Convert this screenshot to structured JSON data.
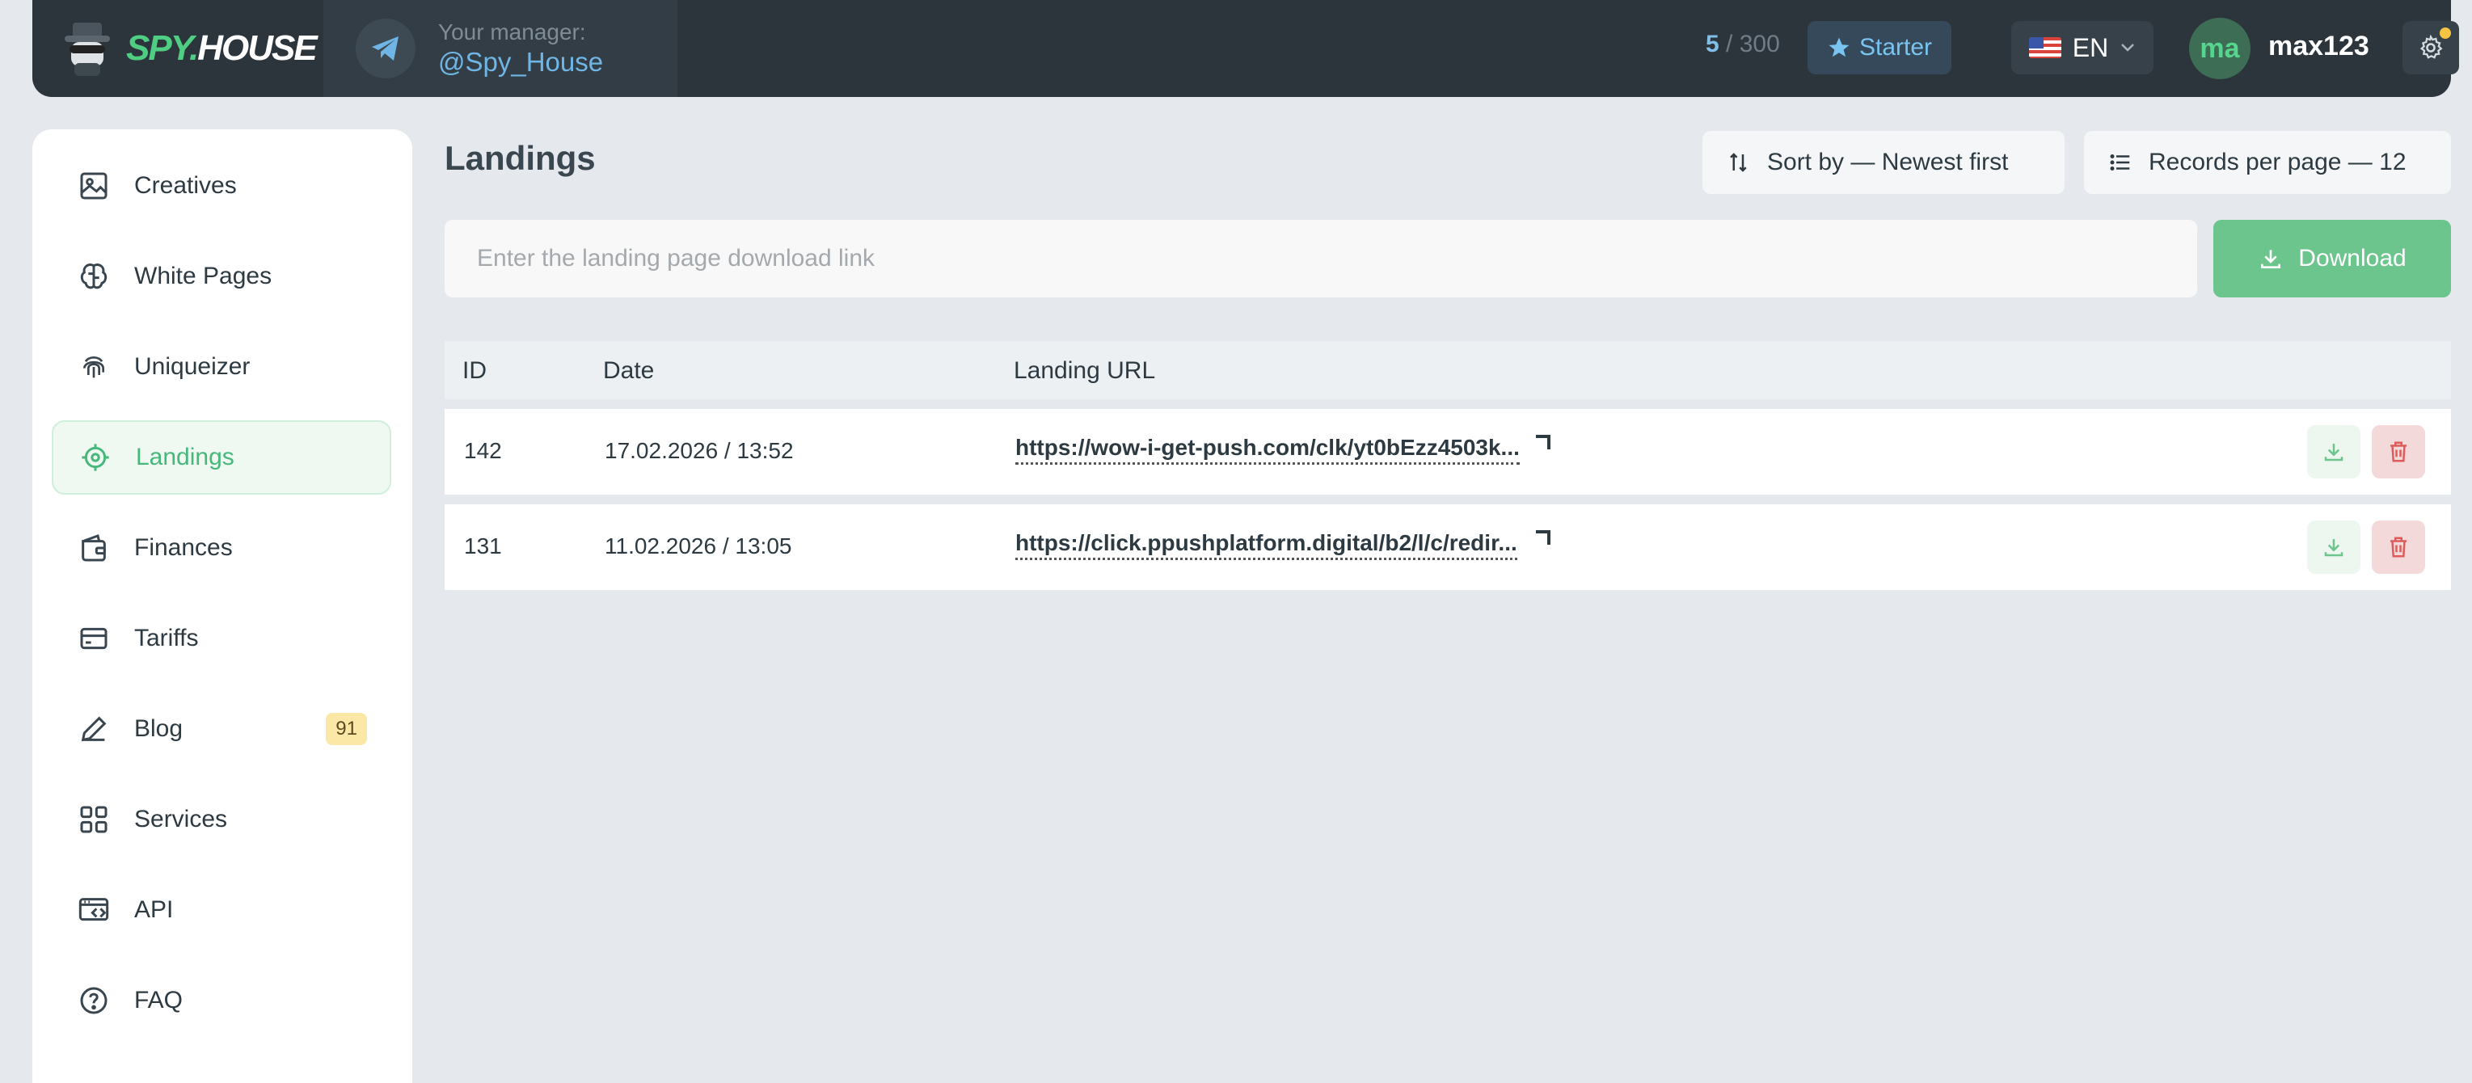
{
  "header": {
    "logo_part1": "SPY.",
    "logo_part2": "HOUSE",
    "manager_label": "Your manager:",
    "manager_handle": "@Spy_House",
    "counter_used": "5",
    "counter_total": "/ 300",
    "plan": "Starter",
    "language": "EN",
    "avatar_initials": "ma",
    "username": "max123"
  },
  "sidebar": {
    "items": [
      {
        "label": "Creatives",
        "icon": "image-icon"
      },
      {
        "label": "White Pages",
        "icon": "brain-icon"
      },
      {
        "label": "Uniqueizer",
        "icon": "fingerprint-icon"
      },
      {
        "label": "Landings",
        "icon": "target-icon",
        "active": true
      },
      {
        "label": "Finances",
        "icon": "wallet-icon"
      },
      {
        "label": "Tariffs",
        "icon": "card-icon"
      },
      {
        "label": "Blog",
        "icon": "pen-icon",
        "badge": "91"
      },
      {
        "label": "Services",
        "icon": "grid-icon"
      },
      {
        "label": "API",
        "icon": "api-icon"
      },
      {
        "label": "FAQ",
        "icon": "help-icon"
      }
    ]
  },
  "main": {
    "title": "Landings",
    "sort_label": "Sort by — Newest first",
    "per_page_label": "Records per page — 12",
    "search_placeholder": "Enter the landing page download link",
    "download_label": "Download",
    "table": {
      "columns": [
        "ID",
        "Date",
        "Landing URL"
      ],
      "rows": [
        {
          "id": "142",
          "date": "17.02.2026 / 13:52",
          "url": "https://wow-i-get-push.com/clk/yt0bEzz4503k..."
        },
        {
          "id": "131",
          "date": "11.02.2026 / 13:05",
          "url": "https://click.ppushplatform.digital/b2/l/c/redir..."
        }
      ]
    }
  },
  "colors": {
    "accent_green": "#6bc58d",
    "header_bg": "#2c353c",
    "badge_bg": "#fbe7a6",
    "delete_red": "#e05a5a"
  }
}
